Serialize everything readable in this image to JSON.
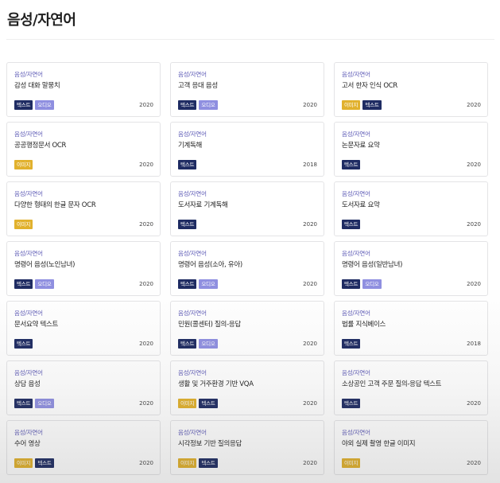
{
  "page": {
    "title": "음성/자연어"
  },
  "colors": {
    "text_tag": "#1f2c63",
    "audio_tag": "#8f8fe0",
    "image_tag": "#e1b12d",
    "category": "#5b58b5"
  },
  "tag_labels": {
    "text": "텍스트",
    "audio": "오디오",
    "image": "이미지"
  },
  "cards": [
    {
      "category": "음성/자연어",
      "name": "감성 대화 말뭉치",
      "tags": [
        "text",
        "audio"
      ],
      "year": "2020"
    },
    {
      "category": "음성/자연어",
      "name": "고객 응대 음성",
      "tags": [
        "text",
        "audio"
      ],
      "year": "2020"
    },
    {
      "category": "음성/자연어",
      "name": "고서 한자 인식 OCR",
      "tags": [
        "image",
        "text"
      ],
      "year": "2020"
    },
    {
      "category": "음성/자연어",
      "name": "공공행정문서 OCR",
      "tags": [
        "image"
      ],
      "year": "2020"
    },
    {
      "category": "음성/자연어",
      "name": "기계독해",
      "tags": [
        "text"
      ],
      "year": "2018"
    },
    {
      "category": "음성/자연어",
      "name": "논문자료 요약",
      "tags": [
        "text"
      ],
      "year": "2020"
    },
    {
      "category": "음성/자연어",
      "name": "다양한 형태의 한글 문자 OCR",
      "tags": [
        "image"
      ],
      "year": "2020"
    },
    {
      "category": "음성/자연어",
      "name": "도서자료 기계독해",
      "tags": [
        "text"
      ],
      "year": "2020"
    },
    {
      "category": "음성/자연어",
      "name": "도서자료 요약",
      "tags": [
        "text"
      ],
      "year": "2020"
    },
    {
      "category": "음성/자연어",
      "name": "명령어 음성(노인남녀)",
      "tags": [
        "text",
        "audio"
      ],
      "year": "2020"
    },
    {
      "category": "음성/자연어",
      "name": "명령어 음성(소아, 유아)",
      "tags": [
        "text",
        "audio"
      ],
      "year": "2020"
    },
    {
      "category": "음성/자연어",
      "name": "명령어 음성(일반남녀)",
      "tags": [
        "text",
        "audio"
      ],
      "year": "2020"
    },
    {
      "category": "음성/자연어",
      "name": "문서요약 텍스트",
      "tags": [
        "text"
      ],
      "year": "2020"
    },
    {
      "category": "음성/자연어",
      "name": "민원(콜센터) 질의-응답",
      "tags": [
        "text",
        "audio"
      ],
      "year": "2020"
    },
    {
      "category": "음성/자연어",
      "name": "법률 지식베이스",
      "tags": [
        "text"
      ],
      "year": "2018"
    },
    {
      "category": "음성/자연어",
      "name": "상담 음성",
      "tags": [
        "text",
        "audio"
      ],
      "year": "2020"
    },
    {
      "category": "음성/자연어",
      "name": "생활 및 거주환경 기반 VQA",
      "tags": [
        "image",
        "text"
      ],
      "year": "2020"
    },
    {
      "category": "음성/자연어",
      "name": "소상공인 고객 주문 질의-응답 텍스트",
      "tags": [
        "text"
      ],
      "year": "2020"
    },
    {
      "category": "음성/자연어",
      "name": "수어 영상",
      "tags": [
        "image",
        "text"
      ],
      "year": "2020"
    },
    {
      "category": "음성/자연어",
      "name": "시각정보 기반 질의응답",
      "tags": [
        "image",
        "text"
      ],
      "year": "2020"
    },
    {
      "category": "음성/자연어",
      "name": "야외 실제 촬영 한글 이미지",
      "tags": [
        "image"
      ],
      "year": "2020"
    }
  ]
}
